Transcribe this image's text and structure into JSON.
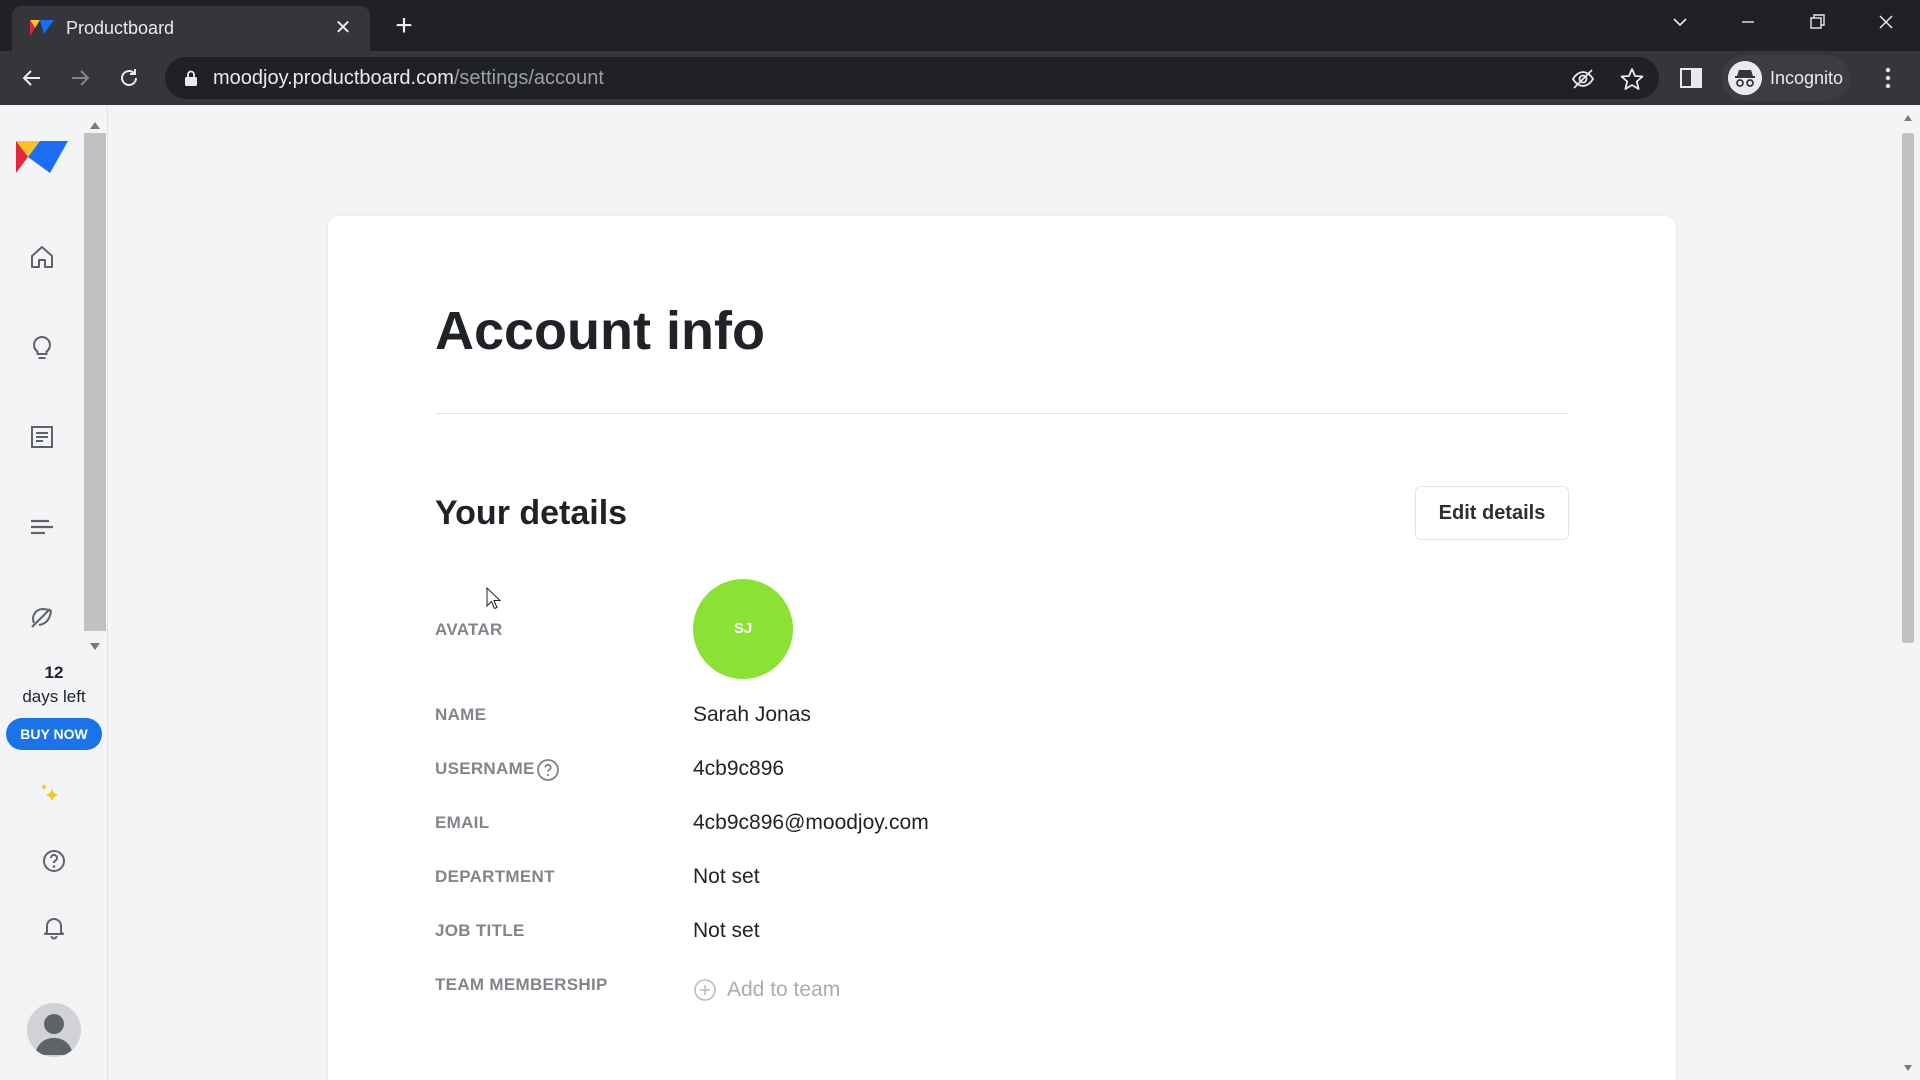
{
  "browser": {
    "tab_title": "Productboard",
    "tab_close": "✕",
    "new_tab": "+",
    "url_host": "moodjoy.productboard.com",
    "url_path": "/settings/account",
    "profile_label": "Incognito"
  },
  "sidebar": {
    "trial_days": "12",
    "trial_label": "days left",
    "buy_now_label": "BUY NOW",
    "icons": [
      "home-icon",
      "insights-bulb-icon",
      "notes-icon",
      "roadmap-icon",
      "portal-off-icon",
      "sparkle-icon",
      "help-icon",
      "bell-icon"
    ]
  },
  "content": {
    "page_title": "Account info",
    "section_title": "Your details",
    "edit_button": "Edit details",
    "fields": {
      "avatar_label": "AVATAR",
      "avatar_initials": "SJ",
      "name_label": "NAME",
      "name_value": "Sarah Jonas",
      "username_label": "USERNAME",
      "username_value": "4cb9c896",
      "email_label": "EMAIL",
      "email_value": "4cb9c896@moodjoy.com",
      "department_label": "DEPARTMENT",
      "department_value": "Not set",
      "job_title_label": "JOB TITLE",
      "job_title_value": "Not set",
      "team_label": "TEAM MEMBERSHIP",
      "team_action": "Add to team"
    }
  },
  "colors": {
    "avatar_bg": "#8ae234",
    "buy_now_bg": "#1a73e8",
    "chrome_dark": "#202124",
    "chrome_toolbar": "#35363a"
  }
}
